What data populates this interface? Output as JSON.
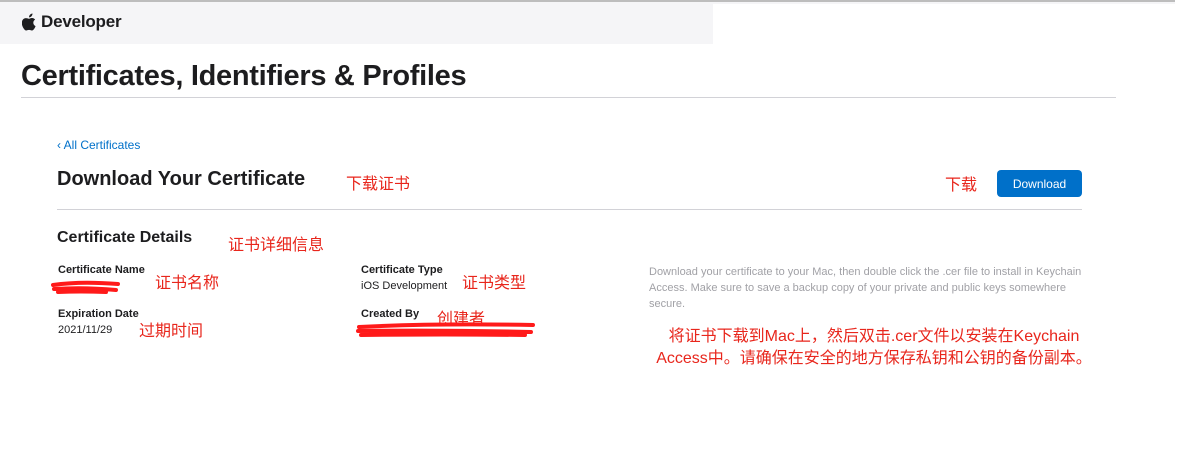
{
  "header": {
    "brand": "Developer",
    "apple_icon": "apple-logo-icon"
  },
  "page": {
    "title": "Certificates, Identifiers & Profiles"
  },
  "nav": {
    "back_link": "‹ All Certificates"
  },
  "main": {
    "title": "Download Your Certificate",
    "download_button": "Download",
    "details_title": "Certificate Details",
    "fields": {
      "certificate_name": {
        "label": "Certificate Name",
        "value": ""
      },
      "certificate_type": {
        "label": "Certificate Type",
        "value": "iOS Development"
      },
      "expiration_date": {
        "label": "Expiration Date",
        "value": "2021/11/29"
      },
      "created_by": {
        "label": "Created By",
        "value": ""
      }
    },
    "help_text": "Download your certificate to your Mac, then double click the .cer file to install in Keychain Access. Make sure to save a backup copy of your private and public keys somewhere secure."
  },
  "annotations": {
    "download_title": "下载证书",
    "download": "下载",
    "details": "证书详细信息",
    "cert_name": "证书名称",
    "cert_type": "证书类型",
    "expiration": "过期时间",
    "created_by": "创建者",
    "instructions": "将证书下载到Mac上，然后双击.cer文件以安装在Keychain Access中。请确保在安全的地方保存私钥和公钥的备份副本。"
  },
  "colors": {
    "accent": "#0070c9",
    "annotation": "#e8261c",
    "redaction": "#ff1a1a",
    "muted_text": "#a1a1a6"
  }
}
